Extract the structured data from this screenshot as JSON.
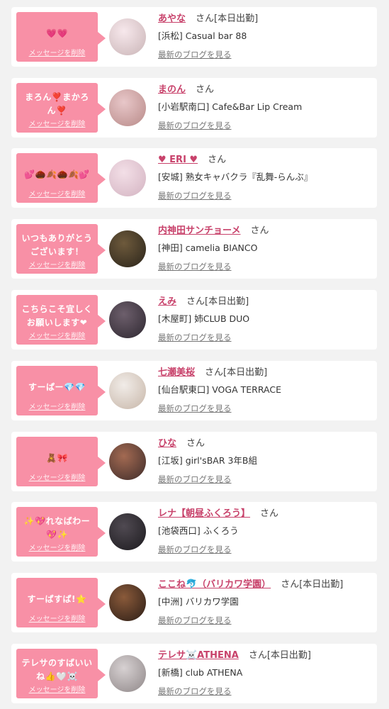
{
  "delete_label": "メッセージを削除",
  "blog_label": "最新のブログを見る",
  "san_label": "さん",
  "cards": [
    {
      "message": "💗💗",
      "name": "あやな",
      "status": "[本日出勤]",
      "location": "[浜松] Casual bar 88",
      "avatar_colors": [
        "#f7e8ec",
        "#c9b4b6"
      ]
    },
    {
      "message": "まろん❣️まかろん❣️",
      "name": "まのん",
      "status": "",
      "location": "[小岩駅南口] Cafe&Bar Lip Cream",
      "avatar_colors": [
        "#e8c7c9",
        "#b88a88"
      ]
    },
    {
      "message": "💕🌰🍂🌰🍂💕",
      "name": "♥ ERI ♥",
      "status": "",
      "location": "[安城] 熟女キャバクラ『乱舞-らんぶ』",
      "avatar_colors": [
        "#f3dfe7",
        "#d3b3c1"
      ]
    },
    {
      "message": "いつもありがとうございます！",
      "name": "内神田サンチョーメ",
      "status": "",
      "location": "[神田] camelia BIANCO",
      "avatar_colors": [
        "#6e5a3c",
        "#2a241a"
      ]
    },
    {
      "message": "こちらこそ宜しくお願いします❤︎",
      "name": "えみ",
      "status": "[本日出勤]",
      "location": "[木屋町] 姉CLUB DUO",
      "avatar_colors": [
        "#6d5f6c",
        "#2e2730"
      ]
    },
    {
      "message": "すーぱー💎💎",
      "name": "七瀬美桜",
      "status": "[本日出勤]",
      "location": "[仙台駅東口] VOGA TERRACE",
      "avatar_colors": [
        "#f1ece8",
        "#c7b6a8"
      ]
    },
    {
      "message": "🧸🎀",
      "name": "ひな",
      "status": "",
      "location": "[江坂] girl'sBAR 3年B組",
      "avatar_colors": [
        "#a36a52",
        "#3e2c2a"
      ]
    },
    {
      "message": "✨💖れなばわー💖✨",
      "name": "レナ【朝昼ふくろう】",
      "status": "",
      "location": "[池袋西口] ふくろう",
      "avatar_colors": [
        "#504a52",
        "#1c1a1e"
      ]
    },
    {
      "message": "すーぱすぱ!⭐",
      "name": "ここね🐬（バリカワ学園）",
      "status": "[本日出勤]",
      "location": "[中洲] バリカワ学園",
      "avatar_colors": [
        "#8a5a3a",
        "#2b1d16"
      ]
    },
    {
      "message": "テレサのすばいいね👍🤍☠️",
      "name": "テレサ☠️ATHENA",
      "status": "[本日出勤]",
      "location": "[新橋] club ATHENA",
      "avatar_colors": [
        "#d7d1d2",
        "#8f8788"
      ]
    }
  ]
}
